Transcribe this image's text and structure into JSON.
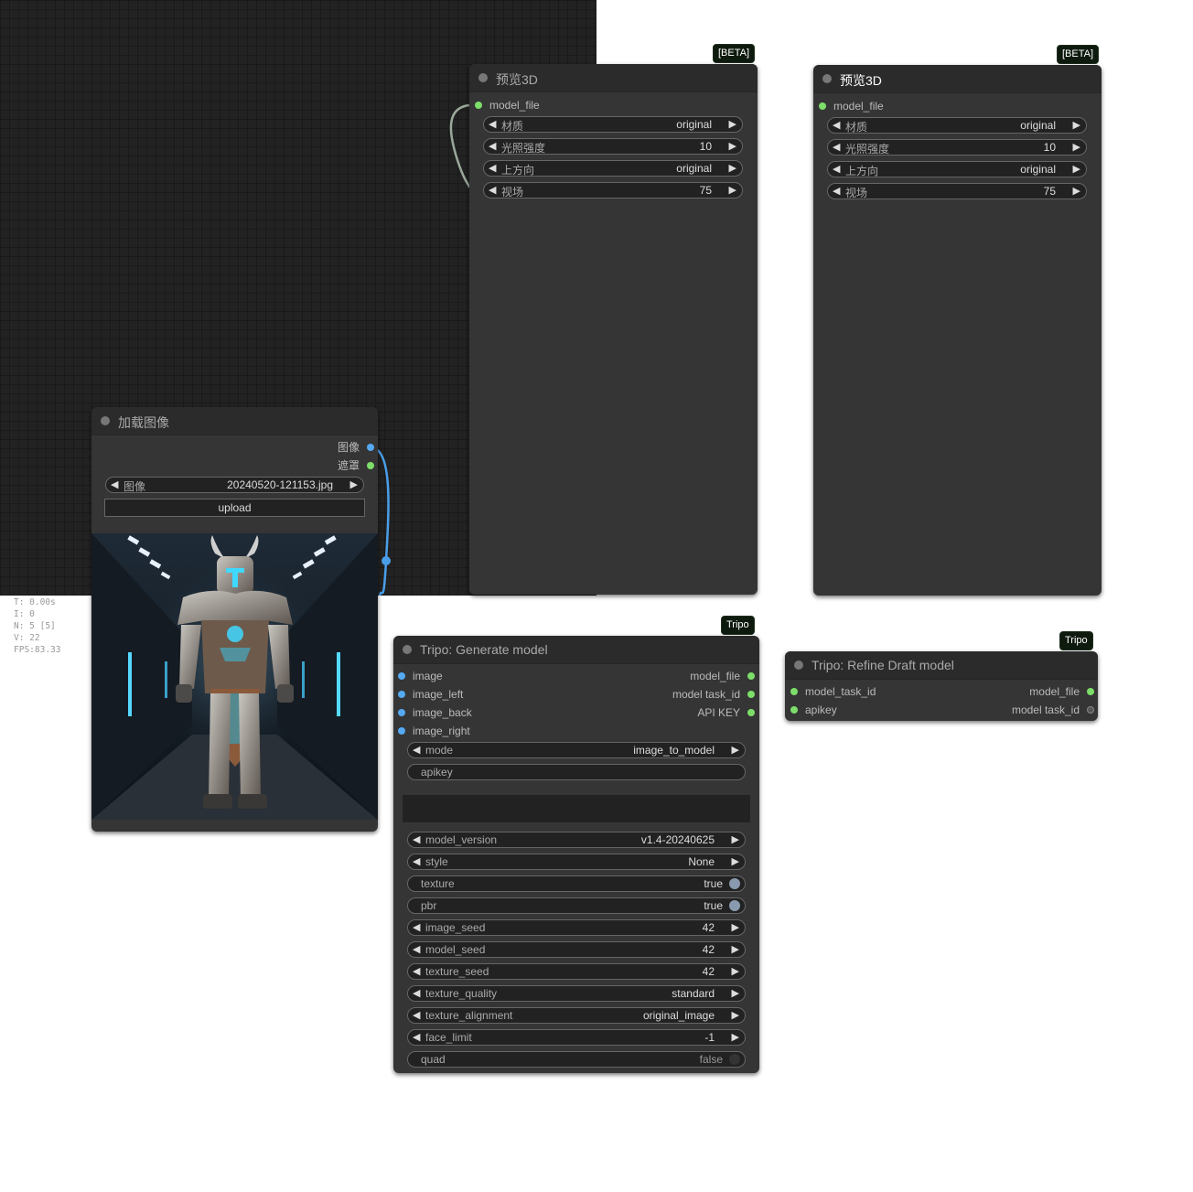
{
  "canvas_stats": {
    "t": "T: 0.00s",
    "i": "I: 0",
    "n": "N: 5 [5]",
    "v": "V: 22",
    "fps": "FPS:83.33"
  },
  "preview_a": {
    "badge": "[BETA]",
    "title": "预览3D",
    "input": "model_file",
    "widgets": [
      {
        "label": "材质",
        "value": "original"
      },
      {
        "label": "光照强度",
        "value": "10"
      },
      {
        "label": "上方向",
        "value": "original"
      },
      {
        "label": "视场",
        "value": "75"
      }
    ]
  },
  "preview_b": {
    "badge": "[BETA]",
    "title": "预览3D",
    "input": "model_file",
    "widgets": [
      {
        "label": "材质",
        "value": "original"
      },
      {
        "label": "光照强度",
        "value": "10"
      },
      {
        "label": "上方向",
        "value": "original"
      },
      {
        "label": "视场",
        "value": "75"
      }
    ]
  },
  "load_image": {
    "title": "加载图像",
    "outputs": [
      "图像",
      "遮罩"
    ],
    "image_widget": {
      "label": "图像",
      "value": "20240520-121153.jpg"
    },
    "upload_label": "upload"
  },
  "generate": {
    "badge": "Tripo",
    "title": "Tripo: Generate model",
    "inputs": [
      "image",
      "image_left",
      "image_back",
      "image_right"
    ],
    "outputs": [
      "model_file",
      "model task_id",
      "API KEY"
    ],
    "mode": {
      "label": "mode",
      "value": "image_to_model"
    },
    "apikey": {
      "label": "apikey"
    },
    "widgets": [
      {
        "label": "model_version",
        "value": "v1.4-20240625"
      },
      {
        "label": "style",
        "value": "None"
      },
      {
        "label": "texture",
        "value": "true"
      },
      {
        "label": "pbr",
        "value": "true"
      },
      {
        "label": "image_seed",
        "value": "42"
      },
      {
        "label": "model_seed",
        "value": "42"
      },
      {
        "label": "texture_seed",
        "value": "42"
      },
      {
        "label": "texture_quality",
        "value": "standard"
      },
      {
        "label": "texture_alignment",
        "value": "original_image"
      },
      {
        "label": "face_limit",
        "value": "-1"
      },
      {
        "label": "quad",
        "value": "false"
      }
    ]
  },
  "refine": {
    "badge": "Tripo",
    "title": "Tripo: Refine Draft model",
    "inputs": [
      "model_task_id",
      "apikey"
    ],
    "outputs": [
      "model_file",
      "model task_id"
    ]
  },
  "colors": {
    "link_blue": "#4a9ee8",
    "link_gray": "#9aa89a",
    "slot_green": "#7dde6a",
    "slot_blue": "#55aaf2"
  },
  "icons": {
    "arrow_left": "◀",
    "arrow_right": "▶"
  }
}
